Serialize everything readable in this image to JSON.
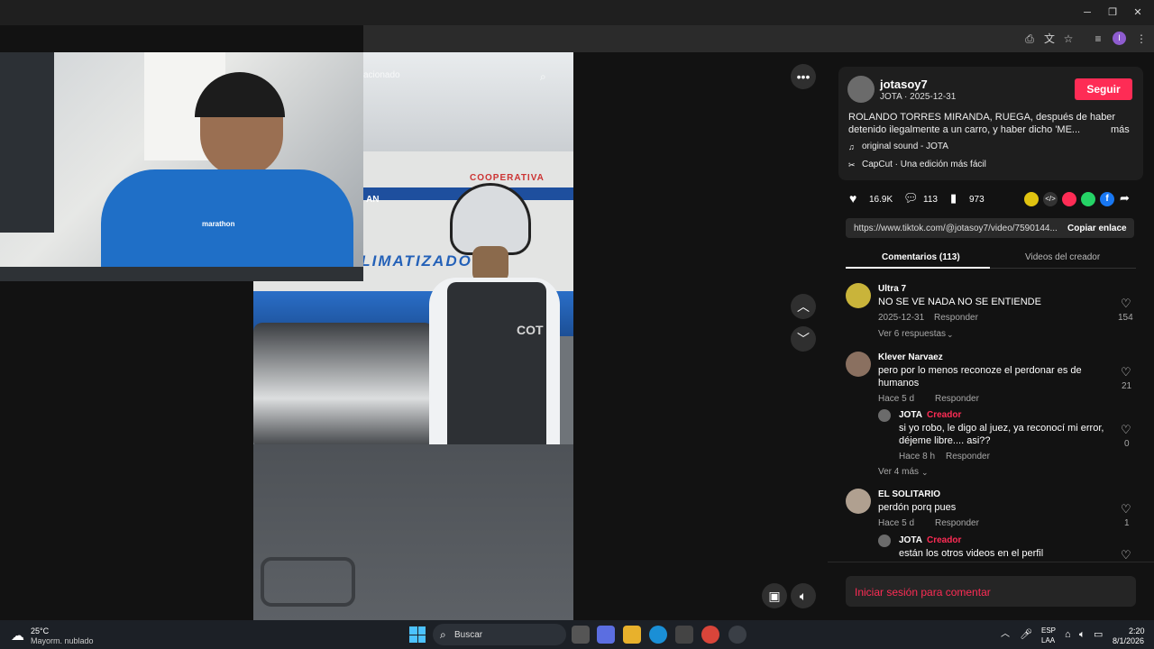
{
  "video": {
    "search_placeholder": "acionado",
    "bus_logo": "CLIMATIZADO",
    "bus_name": "COOPERATIVA",
    "bus_name2": "AN",
    "badge_text": "COT",
    "shirt_brand": "marathon"
  },
  "post": {
    "username": "jotasoy7",
    "subtitle": "JOTA · 2025-12-31",
    "follow_label": "Seguir",
    "description_line1": "ROLANDO TORRES MIRANDA, RUEGA, después de haber",
    "description_line2": "detenido ilegalmente a un carro, y haber dicho 'ME...",
    "more_label": "más",
    "sound": "original sound - JOTA",
    "capcut": "CapCut · Una edición más fácil",
    "likes": "16.9K",
    "comments_count": "113",
    "saves": "973",
    "link": "https://www.tiktok.com/@jotasoy7/video/7590144...",
    "copy_link_label": "Copiar enlace"
  },
  "tabs": {
    "comments": "Comentarios (113)",
    "creator_videos": "Videos del creador"
  },
  "comments": [
    {
      "user": "Ultra 7",
      "text": "NO SE VE NADA NO SE ENTIENDE",
      "date": "2025-12-31",
      "reply": "Responder",
      "likes": "154",
      "view_replies": "Ver 6 respuestas"
    },
    {
      "user": "Klever Narvaez",
      "text1": "pero por lo menos reconoze el perdonar es de",
      "text2": "humanos",
      "date": "Hace 5 d",
      "reply": "Responder",
      "likes": "21",
      "sub": {
        "user": "JOTA",
        "creator": "Creador",
        "sep": " · ",
        "text1": "si yo robo, le digo al juez, ya reconocí mi error,",
        "text2": "déjeme libre.... asi??",
        "date": "Hace 8 h",
        "reply": "Responder",
        "likes": "0"
      },
      "view_more": "Ver 4 más"
    },
    {
      "user": "EL SOLITARIO",
      "text": "perdón porq pues",
      "date": "Hace 5 d",
      "reply": "Responder",
      "likes": "1",
      "sub": {
        "user": "JOTA",
        "creator": "Creador",
        "sep": " · ",
        "text": "están los otros videos en el perfil"
      }
    }
  ],
  "login_prompt": "Iniciar sesión para comentar",
  "taskbar": {
    "temp": "25°C",
    "weather": "Mayorm. nublado",
    "search": "Buscar",
    "lang1": "ESP",
    "lang2": "LAA",
    "time": "2:20",
    "date": "8/1/2026"
  },
  "colors": {
    "accent": "#fe2c55",
    "panel_bg": "#121212",
    "taskbar": "#1c2026"
  }
}
